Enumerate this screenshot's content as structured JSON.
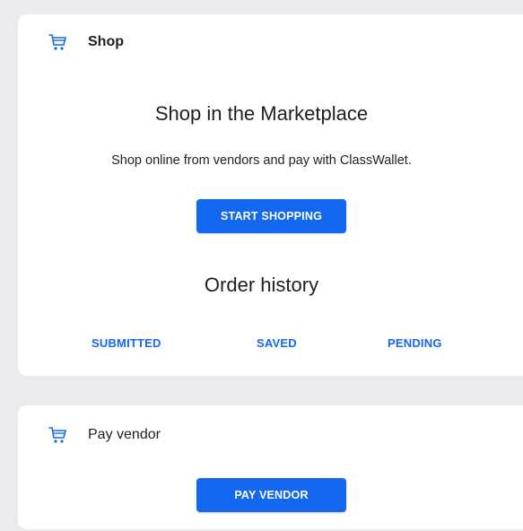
{
  "shop_card": {
    "title": "Shop",
    "icon": "cart-icon",
    "heading": "Shop in the Marketplace",
    "description": "Shop online from vendors and pay with ClassWallet.",
    "start_button": "START SHOPPING",
    "order_history": {
      "heading": "Order history",
      "tabs": [
        "SUBMITTED",
        "SAVED",
        "PENDING"
      ]
    }
  },
  "pay_card": {
    "title": "Pay vendor",
    "icon": "cart-icon",
    "button": "PAY VENDOR"
  },
  "colors": {
    "accent": "#1468f0",
    "background": "#ebebef",
    "card": "#ffffff",
    "text": "#1f1f1f"
  }
}
